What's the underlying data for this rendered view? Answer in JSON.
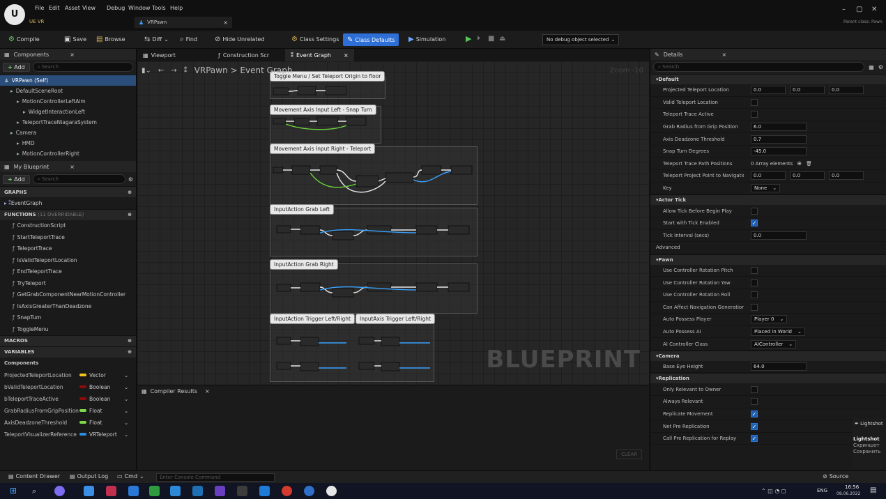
{
  "window": {
    "menu": [
      "File",
      "Edit",
      "Asset",
      "View",
      "Debug",
      "Window",
      "Tools",
      "Help"
    ],
    "project_tab": "UE VR",
    "asset_tab": "VRPawn",
    "parent_class": "Parent class: Pawn",
    "controls": [
      "–",
      "▢",
      "✕"
    ]
  },
  "toolbar": {
    "compile": "Compile",
    "save": "Save",
    "browse": "Browse",
    "diff": "Diff",
    "find": "Find",
    "hide_unrelated": "Hide Unrelated",
    "class_settings": "Class Settings",
    "class_defaults": "Class Defaults",
    "simulation": "Simulation",
    "debug_select": "No debug object selected"
  },
  "components_panel": {
    "tab": "Components",
    "add": "Add",
    "search_placeholder": "Search",
    "items": [
      {
        "label": "VRPawn (Self)",
        "depth": 0
      },
      {
        "label": "DefaultSceneRoot",
        "depth": 1
      },
      {
        "label": "MotionControllerLeftAim",
        "depth": 2
      },
      {
        "label": "WidgetInteractionLeft",
        "depth": 3
      },
      {
        "label": "TeleportTraceNiagaraSystem",
        "depth": 2
      },
      {
        "label": "Camera",
        "depth": 1
      },
      {
        "label": "HMD",
        "depth": 2
      },
      {
        "label": "MotionControllerRight",
        "depth": 2
      }
    ]
  },
  "blueprint_panel": {
    "tab": "My Blueprint",
    "add": "Add",
    "search_placeholder": "Search",
    "graphs_header": "GRAPHS",
    "graphs": [
      "EventGraph"
    ],
    "functions_header": "FUNCTIONS",
    "functions_sub": "(11 OVERRIDABLE)",
    "functions": [
      "ConstructionScript",
      "StartTeleportTrace",
      "TeleportTrace",
      "IsValidTeleportLocation",
      "EndTeleportTrace",
      "TryTeleport",
      "GetGrabComponentNearMotionController",
      "IsAxisGreaterThanDeadzone",
      "SnapTurn",
      "ToggleMenu"
    ],
    "macros_header": "MACROS",
    "variables_header": "VARIABLES",
    "components_group": "Components",
    "variables": [
      {
        "name": "ProjectedTeleportLocation",
        "type": "Vector",
        "color": "#f4c51c"
      },
      {
        "name": "bValidTeleportLocation",
        "type": "Boolean",
        "color": "#8c0c0c"
      },
      {
        "name": "bTeleportTraceActive",
        "type": "Boolean",
        "color": "#8c0c0c"
      },
      {
        "name": "GrabRadiusFromGripPosition",
        "type": "Float",
        "color": "#7dd84a"
      },
      {
        "name": "AxisDeadzoneThreshold",
        "type": "Float",
        "color": "#7dd84a"
      },
      {
        "name": "TeleportVisualizerReference",
        "type": "VRTeleport",
        "color": "#2a8fe0"
      }
    ]
  },
  "center": {
    "tabs": [
      "Viewport",
      "Construction Scr",
      "Event Graph"
    ],
    "breadcrumb_root": "VRPawn",
    "breadcrumb_sep": ">",
    "breadcrumb_leaf": "Event Graph",
    "zoom": "Zoom -10",
    "watermark": "BLUEPRINT",
    "comments": [
      "Toggle Menu / Set Teleport Origin to floor",
      "Movement Axis Input Left - Snap Turn",
      "Movement Axis Input Right - Teleport",
      "InputAction Grab Left",
      "InputAction Grab Right",
      "InputAction Trigger Left/Right",
      "InputAxis Trigger Left/Right"
    ],
    "compiler_tab": "Compiler Results",
    "clear": "CLEAR"
  },
  "details": {
    "tab": "Details",
    "search_placeholder": "Search",
    "sections": [
      {
        "title": "Default",
        "rows": [
          {
            "label": "Projected Teleport Location",
            "kind": "vec",
            "values": [
              "0.0",
              "0.0",
              "0.0"
            ]
          },
          {
            "label": "Valid Teleport Location",
            "kind": "check",
            "on": false
          },
          {
            "label": "Teleport Trace Active",
            "kind": "check",
            "on": false
          },
          {
            "label": "Grab Radius from Grip Position",
            "kind": "num",
            "value": "6.0"
          },
          {
            "label": "Axis Deadzone Threshold",
            "kind": "num",
            "value": "0.7"
          },
          {
            "label": "Snap Turn Degrees",
            "kind": "num",
            "value": "-45.0"
          },
          {
            "label": "Teleport Trace Path Positions",
            "kind": "text",
            "value": "0 Array elements"
          },
          {
            "label": "Teleport Project Point to Navigation Query Extent",
            "kind": "vec",
            "values": [
              "0.0",
              "0.0",
              "0.0"
            ]
          },
          {
            "label": "Key",
            "kind": "dd",
            "value": "None"
          }
        ]
      },
      {
        "title": "Actor Tick",
        "rows": [
          {
            "label": "Allow Tick Before Begin Play",
            "kind": "check",
            "on": false
          },
          {
            "label": "Start with Tick Enabled",
            "kind": "check",
            "on": true
          },
          {
            "label": "Tick Interval (secs)",
            "kind": "num",
            "value": "0.0"
          },
          {
            "label": "Advanced",
            "kind": "sub"
          }
        ]
      },
      {
        "title": "Pawn",
        "rows": [
          {
            "label": "Use Controller Rotation Pitch",
            "kind": "check",
            "on": false
          },
          {
            "label": "Use Controller Rotation Yaw",
            "kind": "check",
            "on": false
          },
          {
            "label": "Use Controller Rotation Roll",
            "kind": "check",
            "on": false
          },
          {
            "label": "Can Affect Navigation Generation",
            "kind": "check",
            "on": false
          },
          {
            "label": "Auto Possess Player",
            "kind": "dd",
            "value": "Player 0"
          },
          {
            "label": "Auto Possess AI",
            "kind": "dd",
            "value": "Placed in World"
          },
          {
            "label": "AI Controller Class",
            "kind": "dd",
            "value": "AIController"
          }
        ]
      },
      {
        "title": "Camera",
        "rows": [
          {
            "label": "Base Eye Height",
            "kind": "num",
            "value": "64.0"
          }
        ]
      },
      {
        "title": "Replication",
        "rows": [
          {
            "label": "Only Relevant to Owner",
            "kind": "check",
            "on": false
          },
          {
            "label": "Always Relevant",
            "kind": "check",
            "on": false
          },
          {
            "label": "Replicate Movement",
            "kind": "check",
            "on": true
          },
          {
            "label": "Net Pre Replication",
            "kind": "check",
            "on": true
          },
          {
            "label": "Call Pre Replication for Replay",
            "kind": "check",
            "on": true
          }
        ]
      }
    ]
  },
  "bottombar": {
    "content_drawer": "Content Drawer",
    "output_log": "Output Log",
    "cmd": "Cmd",
    "console_placeholder": "Enter Console Command",
    "source": "Source"
  },
  "taskbar": {
    "lang": "ENG",
    "time": "16:56",
    "date": "08.06.2022"
  },
  "toast": {
    "title": "Lightshot",
    "lines": [
      "Lightshot",
      "Скриншот",
      "Сохранить"
    ]
  }
}
